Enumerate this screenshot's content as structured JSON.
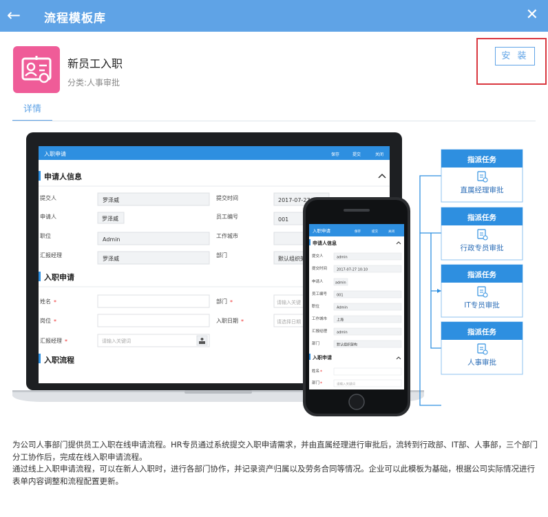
{
  "header": {
    "title": "流程模板库",
    "back_icon": "arrow-left-icon",
    "close_icon": "close-icon"
  },
  "app": {
    "name": "新员工入职",
    "category": "分类:人事审批",
    "icon": "employee-card-icon",
    "icon_color": "#ef5c98",
    "install_label": "安 装"
  },
  "tabs": {
    "details": "详情"
  },
  "desktop": {
    "form_title": "入职申请",
    "save": "保存",
    "submit": "提交",
    "close": "关闭",
    "section1": "申请人信息",
    "section2": "入职申请",
    "section3": "入职流程",
    "l_submitter": "提交人",
    "v_submitter": "罗泽威",
    "l_submit_time": "提交时间",
    "v_submit_time": "2017-07-27 1",
    "l_applicant": "申请人",
    "v_applicant": "罗泽威",
    "l_emp_no": "员工编号",
    "v_emp_no": "001",
    "l_position": "职位",
    "v_position": "Admin",
    "l_city": "工作城市",
    "l_manager": "汇报经理",
    "v_manager": "罗泽威",
    "l_dept": "部门",
    "v_dept": "默认组织架",
    "l_name": "姓名",
    "l_dept2": "部门",
    "p_dept2": "请输入关键",
    "l_post": "岗位",
    "l_join_date": "入职日期",
    "p_join_date": "请选择日期",
    "l_manager2": "汇报经理",
    "p_manager2": "请输入关键词"
  },
  "phone": {
    "form_title": "入职申请",
    "save": "保存",
    "submit": "提交",
    "close": "关闭",
    "section1": "申请人信息",
    "section2": "入职申请",
    "l_submitter": "提交人",
    "v_submitter": "admin",
    "l_submit_time": "提交时间",
    "v_submit_time": "2017-07-27 10:10",
    "l_applicant": "申请人",
    "v_applicant": "admin",
    "l_emp_no": "员工编号",
    "v_emp_no": "001",
    "l_position": "职位",
    "v_position": "Admin",
    "l_city": "工作城市",
    "v_city": "上海",
    "l_manager": "汇报经理",
    "v_manager": "admin",
    "l_dept": "部门",
    "v_dept": "默认组织架构",
    "l_name": "姓名",
    "l_dept2": "部门",
    "p_dept2": "请输入关键词"
  },
  "flow": {
    "task_label": "指派任务",
    "steps": [
      "直属经理审批",
      "行政专员审批",
      "IT专员审批",
      "人事审批"
    ]
  },
  "description": {
    "p1": "为公司人事部门提供员工入职在线申请流程。HR专员通过系统提交入职申请需求，并由直属经理进行审批后，流转到行政部、IT部、人事部，三个部门分工协作后，完成在线入职申请流程。",
    "p2": "通过线上入职申请流程，可以在新人入职时，进行各部门协作，并记录资产归属以及劳务合同等情况。企业可以此模板为基础，根据公司实际情况进行表单内容调整和流程配置更新。"
  },
  "colors": {
    "accent": "#5fa3e6",
    "header_bg": "#5fa3e6",
    "highlight": "#d9363e",
    "task_blue": "#2e8fe0"
  }
}
